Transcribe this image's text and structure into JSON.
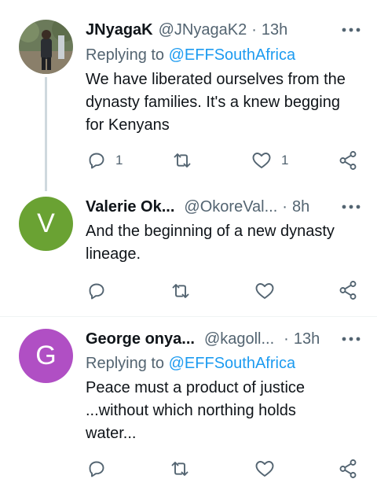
{
  "tweets": [
    {
      "name": "JNyagaK",
      "handle": "@JNyagaK2",
      "time": "13h",
      "replying_label": "Replying to",
      "replying_to": "@EFFSouthAfrica",
      "lines": [
        "We have liberated ourselves from the",
        "dynasty families. It's a knew begging",
        "for Kenyans"
      ],
      "reply_count": "1",
      "like_count": "1"
    },
    {
      "name": "Valerie Ok...",
      "handle": "@OkoreVal...",
      "time": "8h",
      "avatar_letter": "V",
      "avatar_color": "#6aa233",
      "lines": [
        "And the beginning of a new dynasty",
        "lineage."
      ]
    },
    {
      "name": "George onya...",
      "handle": "@kagoll...",
      "time": "13h",
      "avatar_letter": "G",
      "avatar_color": "#b04fc4",
      "replying_label": "Replying to",
      "replying_to": "@EFFSouthAfrica",
      "lines": [
        "Peace must a product of justice",
        "...without which northing holds",
        "water..."
      ]
    }
  ],
  "icons": [
    "reply-icon",
    "retweet-icon",
    "like-icon",
    "share-icon",
    "more-icon"
  ],
  "colors": {
    "link": "#1d9bf0",
    "secondary": "#536471",
    "text": "#0f1419"
  }
}
